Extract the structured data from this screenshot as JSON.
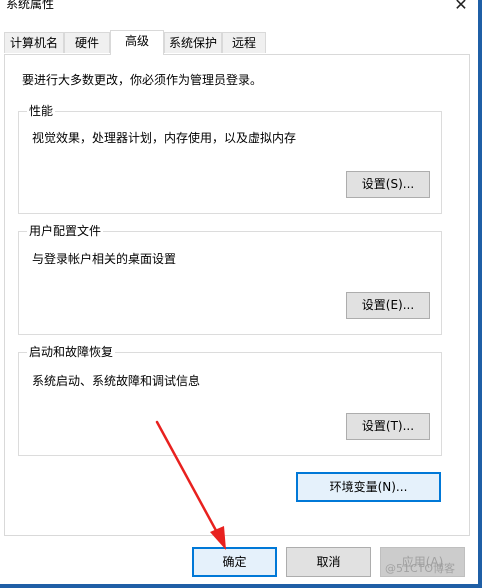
{
  "window": {
    "title": "系统属性"
  },
  "tabs": [
    {
      "label": "计算机名"
    },
    {
      "label": "硬件"
    },
    {
      "label": "高级"
    },
    {
      "label": "系统保护"
    },
    {
      "label": "远程"
    }
  ],
  "admin_note": "要进行大多数更改，你必须作为管理员登录。",
  "groups": {
    "performance": {
      "title": "性能",
      "desc": "视觉效果，处理器计划，内存使用，以及虚拟内存",
      "button": "设置(S)..."
    },
    "profiles": {
      "title": "用户配置文件",
      "desc": "与登录帐户相关的桌面设置",
      "button": "设置(E)..."
    },
    "startup": {
      "title": "启动和故障恢复",
      "desc": "系统启动、系统故障和调试信息",
      "button": "设置(T)..."
    }
  },
  "env_button": "环境变量(N)...",
  "footer": {
    "ok": "确定",
    "cancel": "取消",
    "apply": "应用(A)"
  },
  "watermark": "@51CTO博客",
  "colors": {
    "accent": "#0078d7",
    "arrow": "#e8211f",
    "window_border": "#1f5fa6"
  },
  "icons": {
    "close": "close-icon",
    "annotation": "red-arrow-icon"
  }
}
